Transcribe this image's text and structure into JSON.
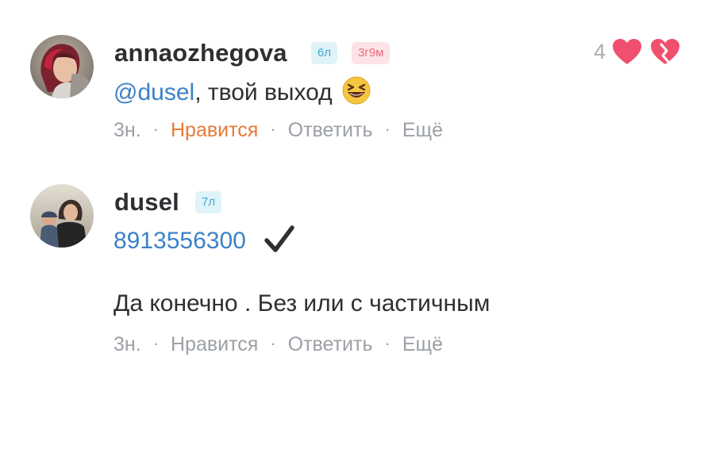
{
  "comments": [
    {
      "username": "annaozhegova",
      "age_badge": "6л",
      "rank_badge": "3г9м",
      "mention": "@dusel",
      "text": ", твой выход",
      "emoji_icon": "laughing-face-icon",
      "like_count": "4",
      "actions": {
        "time": "3н.",
        "like": "Нравится",
        "reply": "Ответить",
        "more": "Ещё"
      },
      "like_active_color": "#e87937"
    },
    {
      "username": "dusel",
      "age_badge": "7л",
      "phone": "8913556300",
      "check_icon": "check-mark-icon",
      "text": "Да конечно . Без или с частичным",
      "actions": {
        "time": "3н.",
        "like": "Нравится",
        "reply": "Ответить",
        "more": "Ещё"
      }
    }
  ],
  "separator": "·",
  "colors": {
    "accent_link": "#3b82c8",
    "meta_gray": "#9ba0a6",
    "heart": "#f0506e",
    "age_badge_bg": "#dff3f8",
    "rank_badge_bg": "#fbe3e6"
  }
}
